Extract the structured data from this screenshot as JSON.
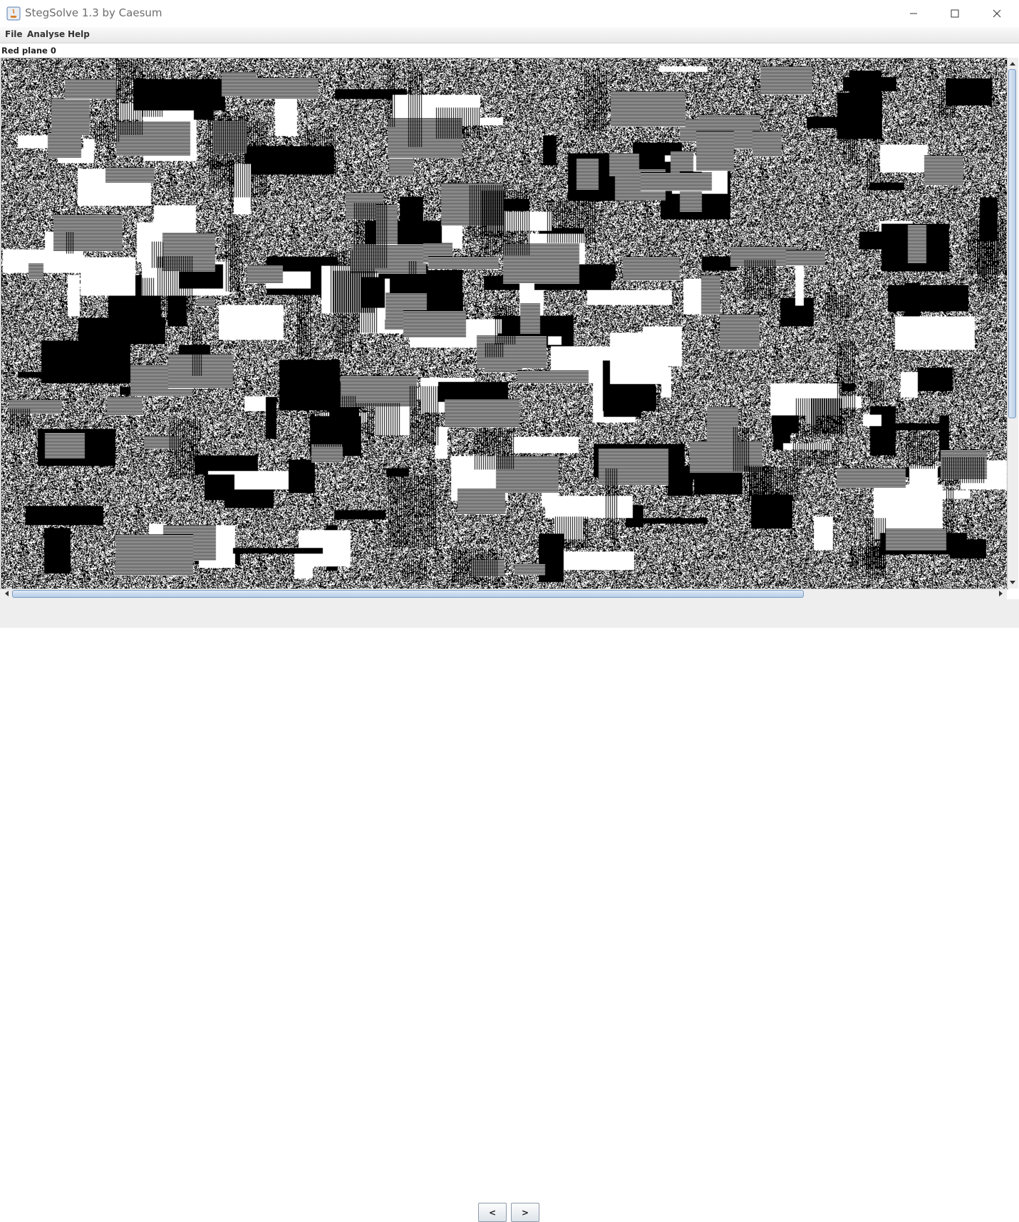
{
  "window": {
    "title": "StegSolve 1.3 by Caesum"
  },
  "menu": {
    "items": [
      "File",
      "Analyse",
      "Help"
    ]
  },
  "status": {
    "label": "Red plane 0"
  },
  "navigation": {
    "prev_label": "<",
    "next_label": ">"
  },
  "image_view": {
    "content": "noise-bitplane"
  },
  "colors": {
    "scroll_thumb": "#b7cde6",
    "window_bg": "#eeeeee"
  }
}
